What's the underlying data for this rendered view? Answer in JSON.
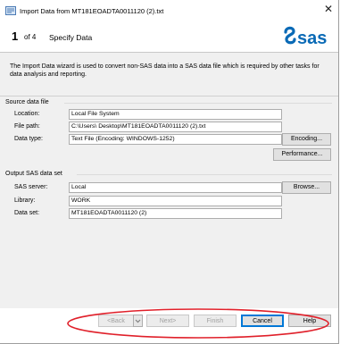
{
  "window": {
    "title": "Import Data from MT181EOADTA0011120 (2).txt",
    "close_glyph": "✕"
  },
  "step": {
    "number": "1",
    "of": "of 4",
    "title": "Specify Data"
  },
  "logo": {
    "text": "sas",
    "color": "#0a6ab6"
  },
  "intro": "The Import Data wizard is used to convert non-SAS data into a SAS data file which is required by other tasks for data analysis and reporting.",
  "source": {
    "section_title": "Source data file",
    "location_label": "Location:",
    "location_value": "Local File System",
    "filepath_label": "File path:",
    "filepath_value": "C:\\Users\\          Desktop\\MT181EOADTA0011120 (2).txt",
    "datatype_label": "Data type:",
    "datatype_value": "Text File  (Encoding: WINDOWS-1252)",
    "encoding_button": "Encoding...",
    "performance_button": "Performance..."
  },
  "output": {
    "section_title": "Output SAS data set",
    "server_label": "SAS server:",
    "server_value": "Local",
    "browse_button": "Browse...",
    "library_label": "Library:",
    "library_value": "WORK",
    "dataset_label": "Data set:",
    "dataset_value": "MT181EOADTA0011120 (2)"
  },
  "footer": {
    "back": "<Back",
    "next": "Next>",
    "finish": "Finish",
    "cancel": "Cancel",
    "help": "Help"
  },
  "colors": {
    "annotation": "#e0202a",
    "accent": "#0078d7",
    "content_bg": "#f0f0f0"
  }
}
